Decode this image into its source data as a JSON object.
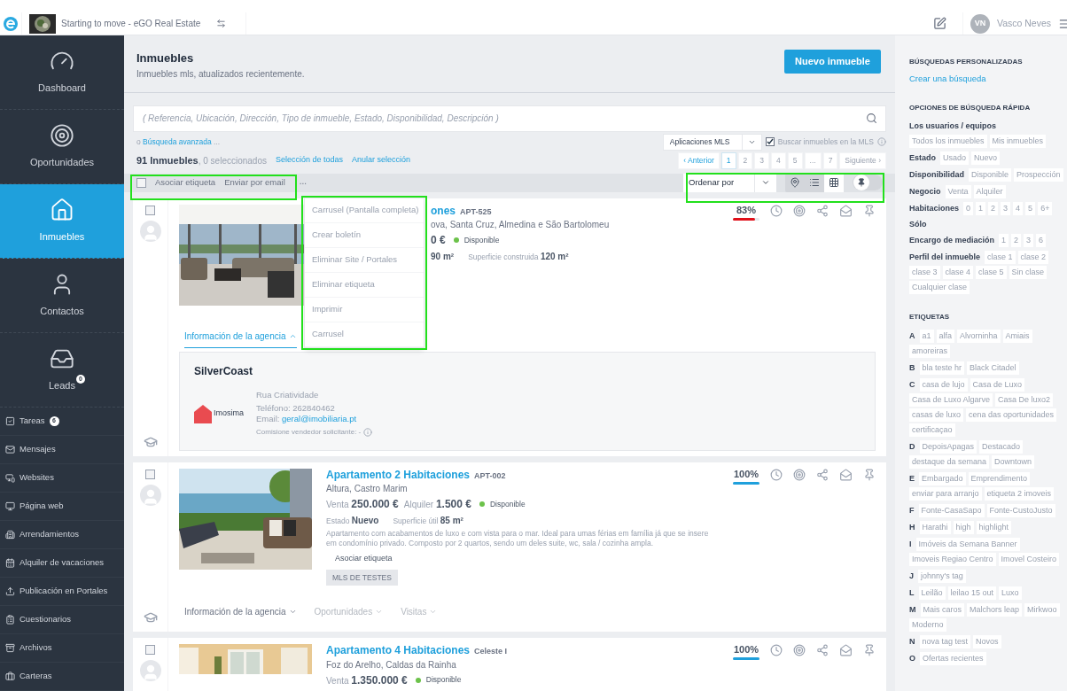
{
  "topbar": {
    "account": "Starting to move - eGO Real Estate",
    "user_initials": "VN",
    "user_name": "Vasco Neves"
  },
  "sidebar": {
    "main_items": [
      {
        "label": "Dashboard",
        "selected": false
      },
      {
        "label": "Oportunidades",
        "selected": false
      },
      {
        "label": "Inmuebles",
        "selected": true
      },
      {
        "label": "Contactos",
        "selected": false
      },
      {
        "label": "Leads",
        "selected": false,
        "badge": "0"
      }
    ],
    "items": [
      {
        "label": "Tareas",
        "badge": "6"
      },
      {
        "label": "Mensajes"
      },
      {
        "label": "Websites"
      },
      {
        "label": "Página web"
      },
      {
        "label": "Arrendamientos"
      },
      {
        "label": "Alquiler de vacaciones"
      },
      {
        "label": "Publicación en Portales"
      },
      {
        "label": "Cuestionarios"
      },
      {
        "label": "Archivos"
      },
      {
        "label": "Carteras"
      }
    ]
  },
  "header": {
    "title": "Inmuebles",
    "subtitle": "Inmuebles mls, atualizados recientemente.",
    "button": "Nuevo inmueble"
  },
  "search": {
    "placeholder": "( Referencia, Ubicación, Dirección, Tipo de inmueble, Estado, Disponibilidad, Descripción )",
    "advanced_prefix": "o",
    "advanced_link": "Búsqueda avanzada",
    "advanced_suffix": "...",
    "source_select": "Aplicaciones MLS",
    "mls_checkbox": {
      "label": "Buscar inmuebles en la MLS",
      "checked": true
    }
  },
  "summary": {
    "count": "91 Inmuebles",
    "selected_text": ", 0 seleccionados",
    "select_all": "Selección de todas",
    "clear": "Anular selección"
  },
  "pagination": [
    {
      "label": "‹ Anterior",
      "selected": false
    },
    {
      "label": "1",
      "selected": true
    },
    {
      "label": "2",
      "selected": false
    },
    {
      "label": "3",
      "selected": false
    },
    {
      "label": "4",
      "selected": false
    },
    {
      "label": "5",
      "selected": false
    },
    {
      "label": "...",
      "selected": false
    },
    {
      "label": "7",
      "selected": false
    },
    {
      "label": "Siguiente ›",
      "selected": false
    }
  ],
  "toolbar": {
    "select_all_checked": false,
    "actions": [
      "Asociar etiqueta",
      "Enviar por email"
    ],
    "more": "...",
    "sort_placeholder": "Ordenar por",
    "views": [
      {
        "selected": false
      },
      {
        "selected": false
      },
      {
        "selected": true
      }
    ],
    "pin_on": false
  },
  "actions_menu": {
    "open": true,
    "items": [
      "Carrusel (Pantalla completa)",
      "Crear boletín",
      "Eliminar Site / Portales",
      "Eliminar etiqueta",
      "Imprimir",
      "Carrusel"
    ]
  },
  "listings": [
    {
      "checked": false,
      "title": "ones",
      "ref": "APT-525",
      "location": "ova, Santa Cruz, Almedina e São Bartolomeu",
      "prices": [
        {
          "value": "0 €"
        }
      ],
      "availability": "Disponible",
      "details": [
        {
          "value": "90 m²"
        },
        {
          "label": "Superficie construida",
          "value": "120 m²"
        }
      ],
      "score": "83%",
      "level": 0.83,
      "tabs": [
        {
          "label": "Información de la agencia",
          "expanded": true,
          "disabled": false
        }
      ],
      "agency": {
        "name": "SilverCoast",
        "logo_text": "Imosima",
        "address": "Rua Criatividade",
        "phone": "Teléfono: 262840462",
        "email_label": "Email:",
        "email": "geral@imobiliaria.pt",
        "commission": "Comisione vendedor solicitante: -"
      }
    },
    {
      "checked": false,
      "title": "Apartamento 2 Habitaciones",
      "ref": "APT-002",
      "location": "Altura, Castro Marim",
      "prices": [
        {
          "label": "Venta",
          "value": "250.000 €"
        },
        {
          "label": "Alquiler",
          "value": "1.500 €"
        }
      ],
      "availability": "Disponible",
      "details": [
        {
          "label": "Estado",
          "value": "Nuevo"
        },
        {
          "label": "Superficie útil",
          "value": "85 m²"
        }
      ],
      "description": "Apartamento com acabamentos de luxo e com vista para o mar. Ideal para umas férias em família já que se insere em condomínio privado. Composto por 2 quartos, sendo um deles suite, wc, sala / cozinha ampla.",
      "tag_action": "Asociar etiqueta",
      "tags": [
        "MLS DE TESTES"
      ],
      "score": "100%",
      "level": 1,
      "tabs": [
        {
          "label": "Información de la agencia",
          "expanded": false,
          "disabled": false
        },
        {
          "label": "Oportunidades",
          "expanded": false,
          "disabled": true
        },
        {
          "label": "Visitas",
          "expanded": false,
          "disabled": true
        }
      ]
    },
    {
      "checked": false,
      "title": "Apartamento 4 Habitaciones",
      "ref": "Celeste I",
      "location": "Foz do Arelho, Caldas da Rainha",
      "prices": [
        {
          "label": "Venta",
          "value": "1.350.000 €"
        }
      ],
      "availability": "Disponible",
      "score": "100%",
      "level": 1
    }
  ],
  "right_panel": {
    "custom_title": "BÚSQUEDAS PERSONALIZADAS",
    "custom_link": "Crear una búsqueda",
    "quick_title": "OPCIONES DE BÚSQUEDA RÁPIDA",
    "filters": [
      {
        "label": "Los usuarios / equipos",
        "block": true,
        "chips": [
          "Todos los inmuebles",
          "Mis inmuebles"
        ]
      },
      {
        "label": "Estado",
        "chips": [
          "Usado",
          "Nuevo"
        ]
      },
      {
        "label": "Disponibilidad",
        "chips": [
          "Disponible",
          "Prospección"
        ]
      },
      {
        "label": "Negocio",
        "chips": [
          "Venta",
          "Alquiler"
        ]
      },
      {
        "label": "Habitaciones",
        "chips": [
          "0",
          "1",
          "2",
          "3",
          "4",
          "5",
          "6+"
        ]
      },
      {
        "label": "Sólo"
      },
      {
        "label": "Encargo de mediación",
        "chips": [
          "1",
          "2",
          "3",
          "6"
        ]
      },
      {
        "label": "Perfil del inmueble",
        "chips": [
          "clase 1",
          "clase 2",
          "clase 3",
          "clase 4",
          "clase 5",
          "Sin clase",
          "Cualquier clase"
        ]
      }
    ],
    "tags_title": "ETIQUETAS",
    "tag_groups": [
      {
        "letter": "A",
        "tags": [
          "a1",
          "alfa",
          "Alvorninha",
          "Amiais",
          "amoreiras"
        ]
      },
      {
        "letter": "B",
        "tags": [
          "bla teste hr",
          "Black Citadel"
        ]
      },
      {
        "letter": "C",
        "tags": [
          "casa de lujo",
          "Casa de Luxo",
          "Casa de Luxo Algarve",
          "Casa De luxo2",
          "casas de luxo",
          "cena das oportunidades",
          "certificaçao"
        ]
      },
      {
        "letter": "D",
        "tags": [
          "DepoisApagas",
          "Destacado",
          "destaque da semana",
          "Downtown"
        ]
      },
      {
        "letter": "E",
        "tags": [
          "Embargado",
          "Emprendimento",
          "enviar para arranjo",
          "etiqueta 2 imoveis"
        ]
      },
      {
        "letter": "F",
        "tags": [
          "Fonte-CasaSapo",
          "Fonte-CustoJusto"
        ]
      },
      {
        "letter": "H",
        "tags": [
          "Harathi",
          "high",
          "highlight"
        ]
      },
      {
        "letter": "I",
        "tags": [
          "Imóveis da Semana Banner",
          "Imoveis Regiao Centro",
          "Imovel Costeiro"
        ]
      },
      {
        "letter": "J",
        "tags": [
          "johnny's tag"
        ]
      },
      {
        "letter": "L",
        "tags": [
          "Leilão",
          "leilao 15 out",
          "Luxo"
        ]
      },
      {
        "letter": "M",
        "tags": [
          "Mais caros",
          "Malchors leap",
          "Mirkwoo",
          "Moderno"
        ]
      },
      {
        "letter": "N",
        "tags": [
          "nova tag test",
          "Novos"
        ]
      },
      {
        "letter": "O",
        "tags": [
          "Ofertas recientes"
        ]
      }
    ]
  }
}
